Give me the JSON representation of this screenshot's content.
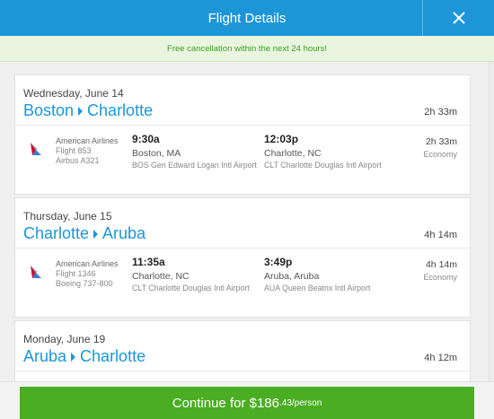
{
  "header": {
    "title": "Flight Details",
    "close_icon": "close-icon"
  },
  "notice": "Free cancellation within the next 24 hours!",
  "legs": [
    {
      "date": "Wednesday, June 14",
      "from": "Boston",
      "to": "Charlotte",
      "duration": "2h 33m",
      "segment": {
        "airline": "American Airlines",
        "flight": "Flight 853",
        "aircraft": "Airbus A321",
        "dep_time": "9:30a",
        "dep_city": "Boston, MA",
        "dep_airport": "BOS Gen Edward Logan Intl Airport",
        "arr_time": "12:03p",
        "arr_city": "Charlotte, NC",
        "arr_airport": "CLT Charlotte Douglas Intl Airport",
        "duration": "2h 33m",
        "cabin": "Economy"
      }
    },
    {
      "date": "Thursday, June 15",
      "from": "Charlotte",
      "to": "Aruba",
      "duration": "4h 14m",
      "segment": {
        "airline": "American Airlines",
        "flight": "Flight 1346",
        "aircraft": "Boeing 737-800",
        "dep_time": "11:35a",
        "dep_city": "Charlotte, NC",
        "dep_airport": "CLT Charlotte Douglas Intl Airport",
        "arr_time": "3:49p",
        "arr_city": "Aruba, Aruba",
        "arr_airport": "AUA Queen Beatrix Intl Airport",
        "duration": "4h 14m",
        "cabin": "Economy"
      }
    },
    {
      "date": "Monday, June 19",
      "from": "Aruba",
      "to": "Charlotte",
      "duration": "4h 12m"
    }
  ],
  "footer": {
    "button_main": "Continue for $186",
    "button_cents": ".43/person"
  },
  "colors": {
    "header": "#1d96d8",
    "accent": "#1d96d8",
    "notice_text": "#3d9e22",
    "button": "#4bad22"
  }
}
